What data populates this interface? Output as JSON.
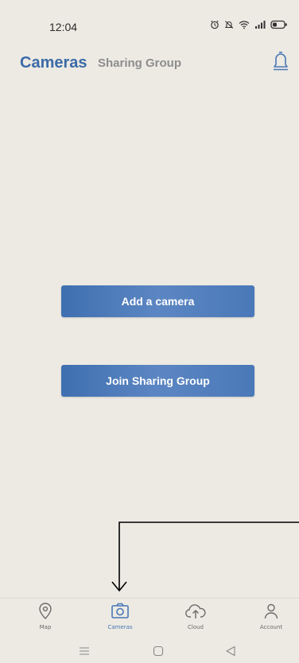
{
  "status_bar": {
    "time": "12:04",
    "icons": [
      "alarm-icon",
      "mute-icon",
      "wifi-icon",
      "signal-icon",
      "battery-icon"
    ]
  },
  "header": {
    "tabs": [
      {
        "label": "Cameras",
        "active": true
      },
      {
        "label": "Sharing Group",
        "active": false
      }
    ],
    "notification_icon": "bell-icon"
  },
  "main": {
    "add_camera_label": "Add a camera",
    "join_group_label": "Join Sharing Group"
  },
  "bottom_nav": {
    "items": [
      {
        "label": "Map",
        "icon": "location-pin-icon",
        "active": false
      },
      {
        "label": "Cameras",
        "icon": "camera-icon",
        "active": true
      },
      {
        "label": "Cloud",
        "icon": "cloud-upload-icon",
        "active": false
      },
      {
        "label": "Account",
        "icon": "user-icon",
        "active": false
      }
    ]
  },
  "system_nav": {
    "buttons": [
      "menu-icon",
      "home-icon",
      "back-icon"
    ]
  },
  "colors": {
    "background": "#eceae3",
    "accent": "#3c6aa8",
    "button": "#4a78b8",
    "inactive_tab": "#8d8d8d"
  }
}
